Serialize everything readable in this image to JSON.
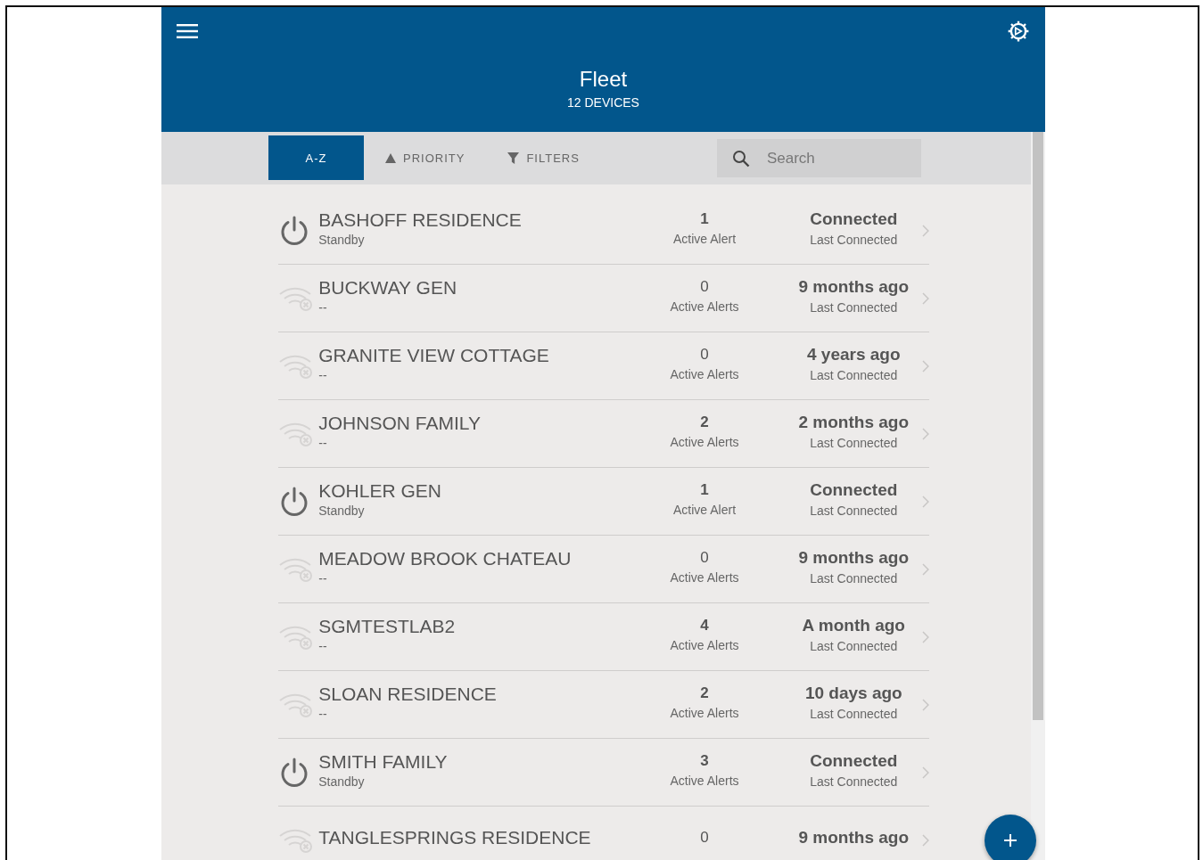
{
  "header": {
    "title": "Fleet",
    "subtitle": "12 DEVICES"
  },
  "sort_tabs": [
    {
      "label": "A-Z",
      "kind": "plain",
      "selected": true
    },
    {
      "label": "PRIORITY",
      "kind": "priority",
      "selected": false
    },
    {
      "label": "FILTERS",
      "kind": "filter",
      "selected": false
    }
  ],
  "search": {
    "placeholder": "Search"
  },
  "devices": [
    {
      "name": "BASHOFF RESIDENCE",
      "status": "Standby",
      "kind": "standby",
      "alert_count": "1",
      "alerts_label": "Active Alert",
      "alerting": true,
      "connection": "Connected",
      "connection_label": "Last Connected"
    },
    {
      "name": "BUCKWAY GEN",
      "status": "--",
      "kind": "offline",
      "alert_count": "0",
      "alerts_label": "Active Alerts",
      "alerting": false,
      "connection": "9 months ago",
      "connection_label": "Last Connected"
    },
    {
      "name": "GRANITE VIEW COTTAGE",
      "status": "--",
      "kind": "offline",
      "alert_count": "0",
      "alerts_label": "Active Alerts",
      "alerting": false,
      "connection": "4 years ago",
      "connection_label": "Last Connected"
    },
    {
      "name": "JOHNSON FAMILY",
      "status": "--",
      "kind": "offline",
      "alert_count": "2",
      "alerts_label": "Active Alerts",
      "alerting": true,
      "connection": "2 months ago",
      "connection_label": "Last Connected"
    },
    {
      "name": "KOHLER GEN",
      "status": "Standby",
      "kind": "standby",
      "alert_count": "1",
      "alerts_label": "Active Alert",
      "alerting": true,
      "connection": "Connected",
      "connection_label": "Last Connected"
    },
    {
      "name": "MEADOW BROOK CHATEAU",
      "status": "--",
      "kind": "offline",
      "alert_count": "0",
      "alerts_label": "Active Alerts",
      "alerting": false,
      "connection": "9 months ago",
      "connection_label": "Last Connected"
    },
    {
      "name": "SGMTESTLAB2",
      "status": "--",
      "kind": "offline",
      "alert_count": "4",
      "alerts_label": "Active Alerts",
      "alerting": true,
      "connection": "A month ago",
      "connection_label": "Last Connected"
    },
    {
      "name": "SLOAN RESIDENCE",
      "status": "--",
      "kind": "offline",
      "alert_count": "2",
      "alerts_label": "Active Alerts",
      "alerting": true,
      "connection": "10 days ago",
      "connection_label": "Last Connected"
    },
    {
      "name": "SMITH FAMILY",
      "status": "Standby",
      "kind": "standby",
      "alert_count": "3",
      "alerts_label": "Active Alerts",
      "alerting": true,
      "connection": "Connected",
      "connection_label": "Last Connected"
    },
    {
      "name": "TANGLESPRINGS RESIDENCE",
      "kind": "offline",
      "alert_count": "0",
      "alerting": false,
      "connection": "9 months ago"
    }
  ]
}
